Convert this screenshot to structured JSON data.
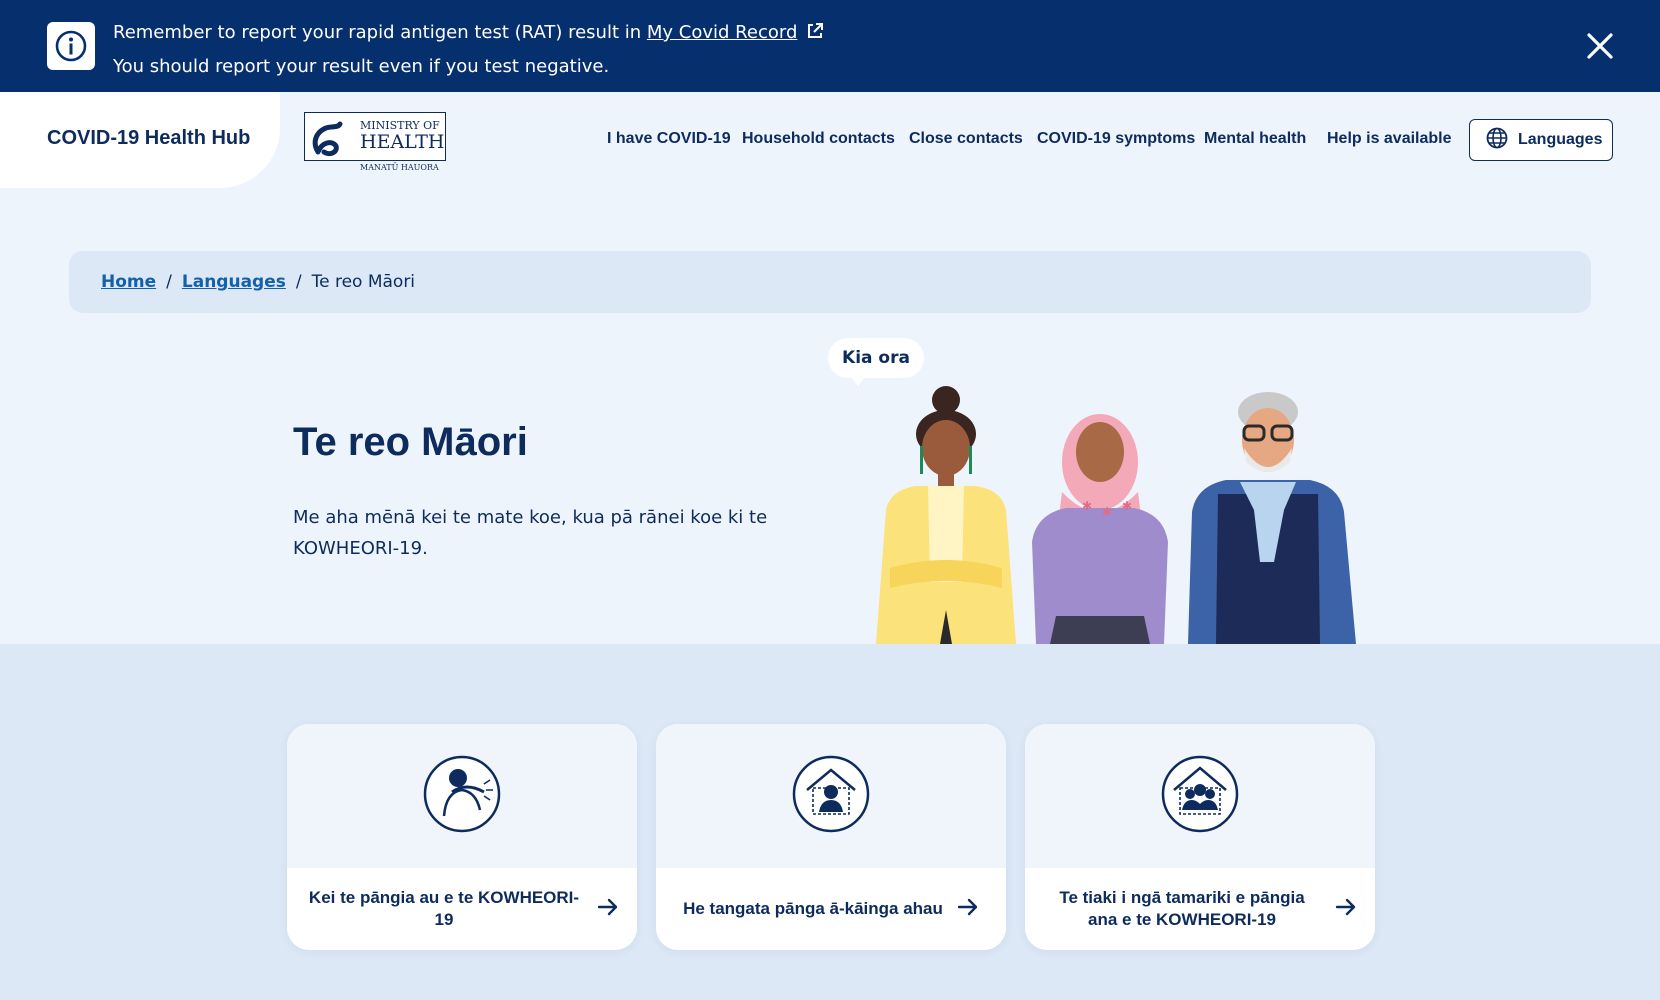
{
  "alert": {
    "line1_prefix": "Remember to report your rapid antigen test (RAT) result in",
    "link_text": "My Covid Record",
    "line2": "You should report your result even if you test negative."
  },
  "header": {
    "brand_name": "COVID-19 Health Hub",
    "logo": {
      "line1": "MINISTRY OF",
      "line2": "HEALTH",
      "line3": "MANATŪ HAUORA"
    },
    "nav": [
      "I have COVID-19",
      "Household contacts",
      "Close contacts",
      "COVID-19 symptoms",
      "Mental health",
      "Help is available"
    ],
    "languages_label": "Languages"
  },
  "breadcrumb": {
    "home": "Home",
    "languages": "Languages",
    "current": "Te reo Māori",
    "separator": "/"
  },
  "hero": {
    "title": "Te reo Māori",
    "intro": "Me aha mēnā kei te mate koe, kua pā rānei koe ki te KOWHEORI-19.",
    "bubble": "Kia ora"
  },
  "cards": [
    {
      "label": "Kei te pāngia au e te KOWHEORI-19",
      "icon": "sick-person-icon"
    },
    {
      "label": "He tangata pānga ā-kāinga ahau",
      "icon": "household-person-icon"
    },
    {
      "label": "Te tiaki i ngā tamariki e pāngia ana e te KOWHEORI-19",
      "icon": "family-house-icon"
    }
  ],
  "colors": {
    "navy": "#062f6e",
    "text": "#0d2b5c",
    "link": "#1460aa",
    "hero_bg": "#eef4fb",
    "lower_bg": "#dce8f6"
  }
}
